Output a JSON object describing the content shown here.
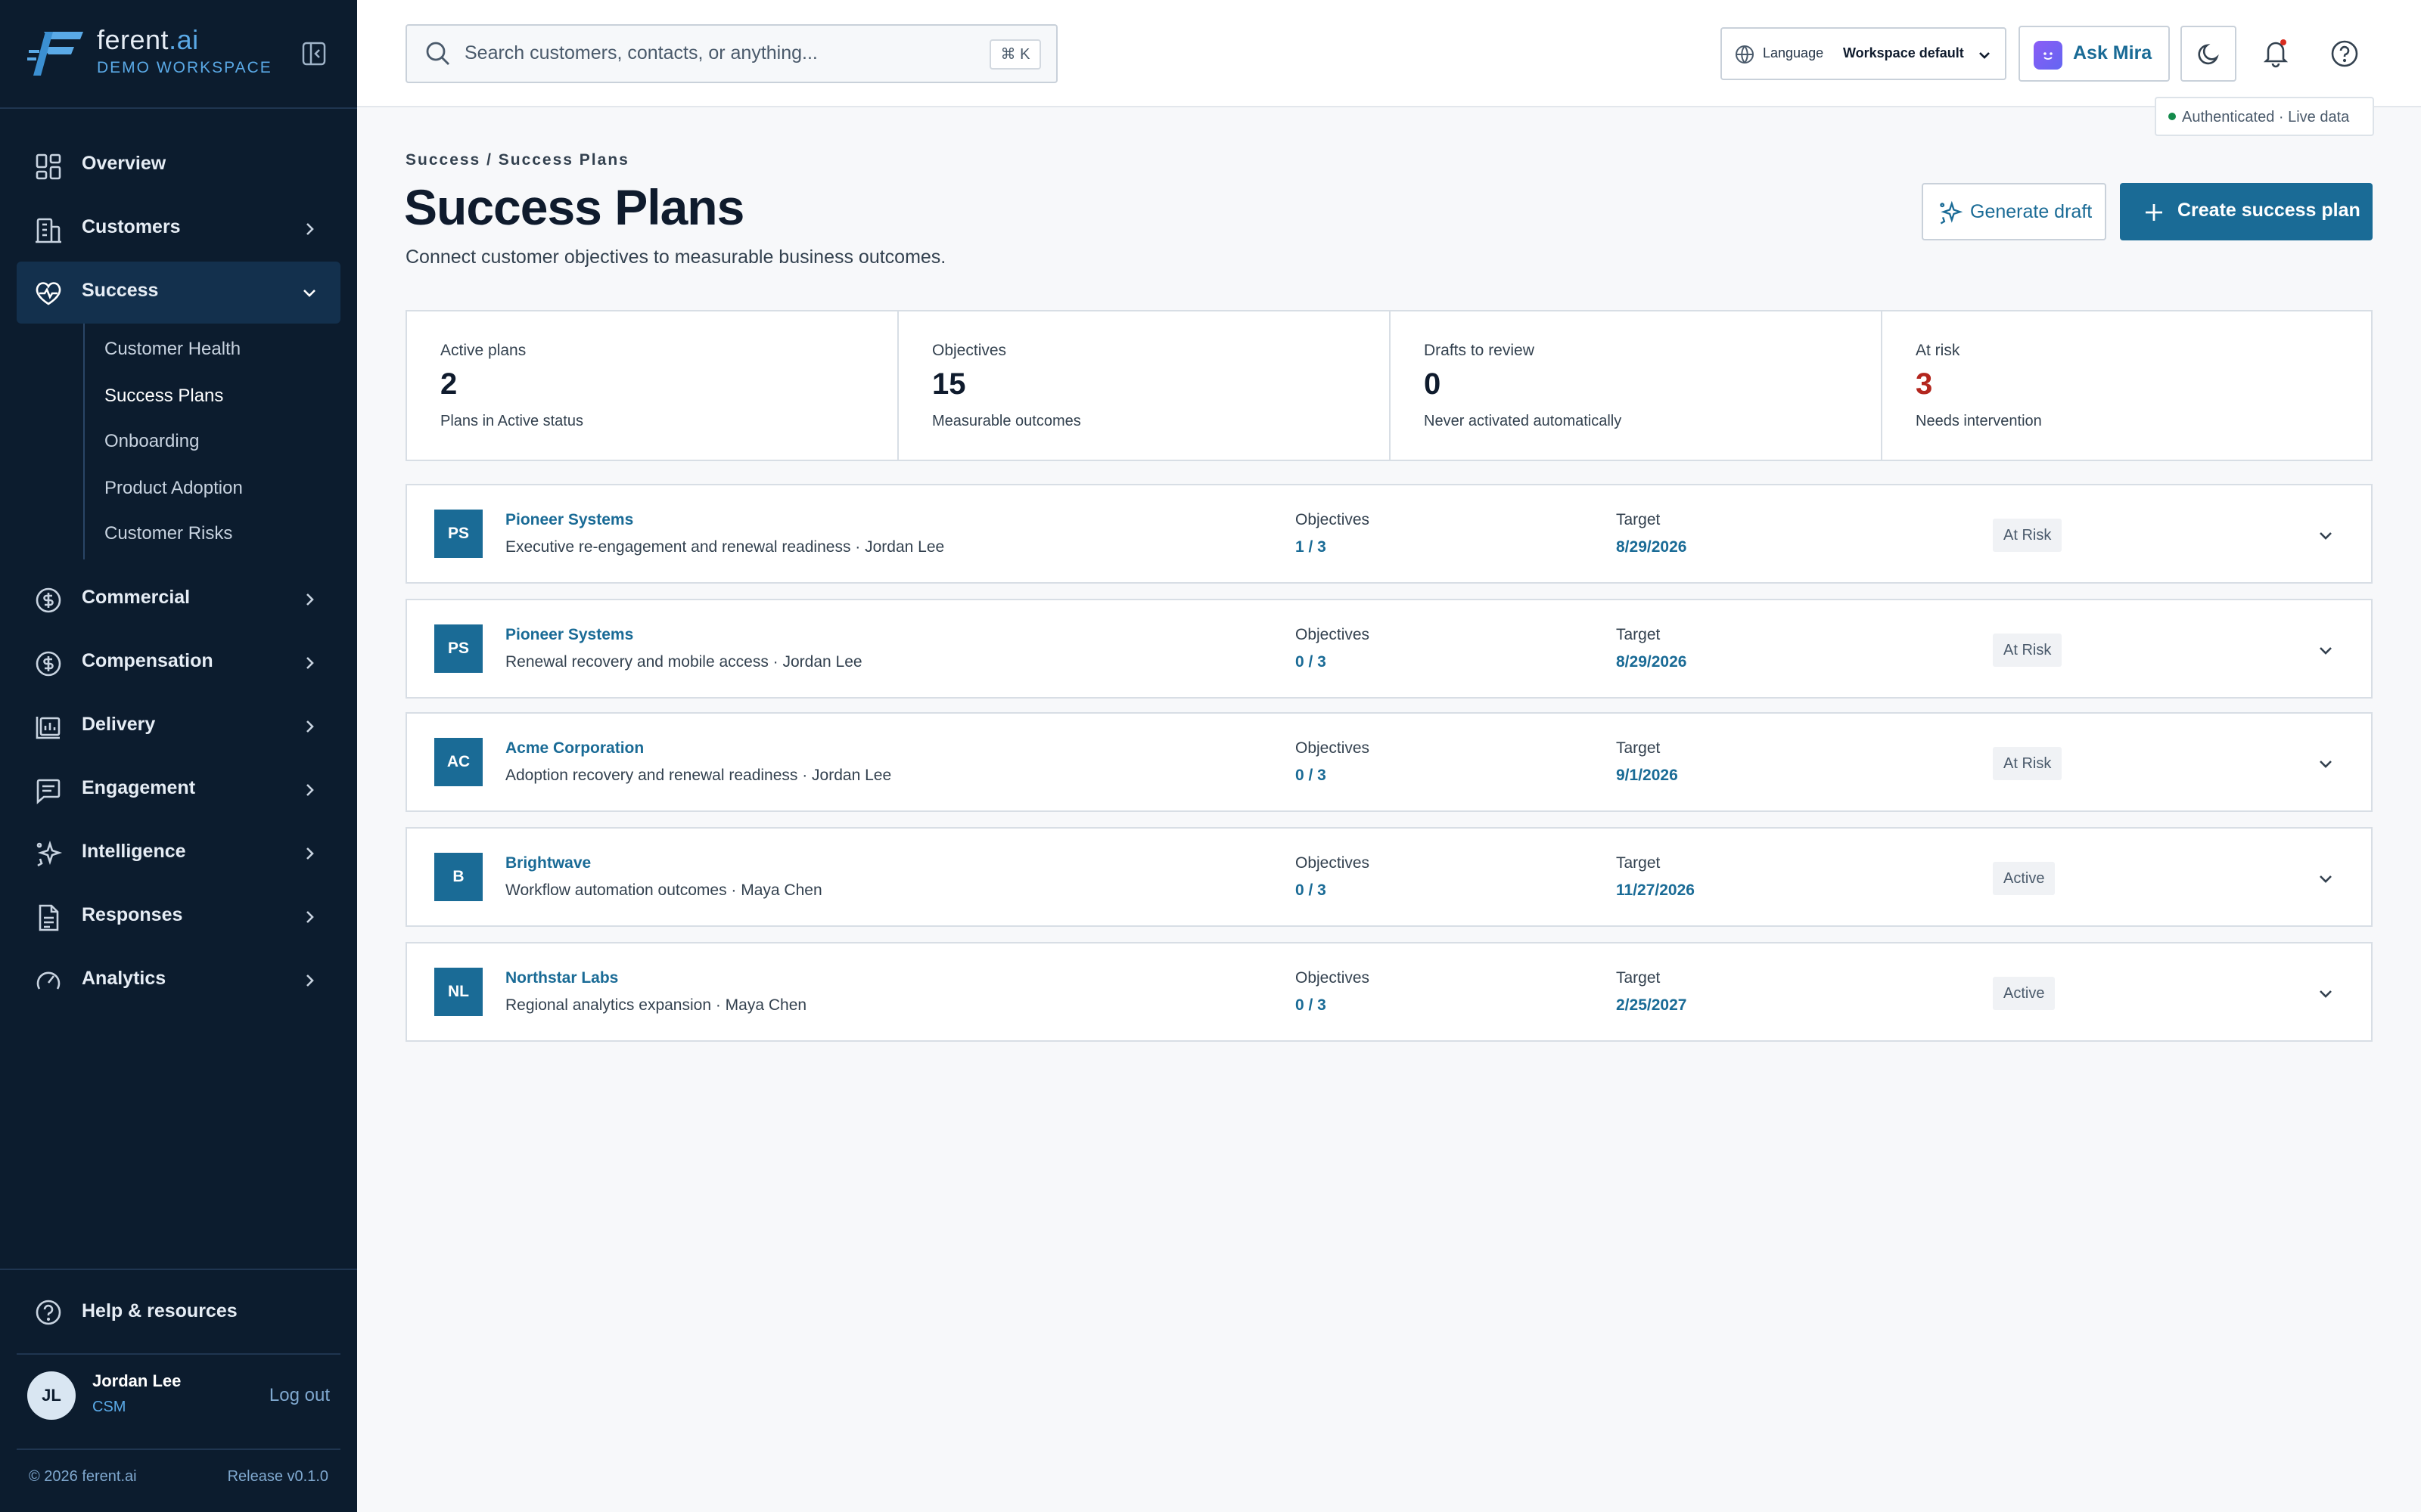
{
  "brand": {
    "name_a": "ferent",
    "name_b": ".ai",
    "workspace": "DEMO WORKSPACE"
  },
  "sidebar": {
    "items": [
      {
        "label": "Overview",
        "icon": "grid-icon"
      },
      {
        "label": "Customers",
        "icon": "building-icon"
      },
      {
        "label": "Success",
        "icon": "heart-pulse-icon",
        "expanded": true
      },
      {
        "label": "Commercial",
        "icon": "dollar-circle-icon"
      },
      {
        "label": "Compensation",
        "icon": "dollar-circle-icon"
      },
      {
        "label": "Delivery",
        "icon": "chart-box-icon"
      },
      {
        "label": "Engagement",
        "icon": "message-icon"
      },
      {
        "label": "Intelligence",
        "icon": "sparkle-icon"
      },
      {
        "label": "Responses",
        "icon": "document-icon"
      },
      {
        "label": "Analytics",
        "icon": "gauge-icon"
      }
    ],
    "sub_items": [
      "Customer Health",
      "Success Plans",
      "Onboarding",
      "Product Adoption",
      "Customer Risks"
    ],
    "current_sub": "Success Plans",
    "help": "Help & resources",
    "user": {
      "initials": "JL",
      "name": "Jordan Lee",
      "role": "CSM",
      "logout": "Log out"
    },
    "footer": {
      "copyright": "© 2026 ferent.ai",
      "release": "Release v0.1.0"
    }
  },
  "topbar": {
    "search_placeholder": "Search customers, contacts, or anything...",
    "shortcut": "⌘ K",
    "language_label": "Language",
    "language_value": "Workspace default",
    "ask": "Ask Mira",
    "auth_status": "Authenticated · Live data"
  },
  "page": {
    "breadcrumb": "Success / Success Plans",
    "title": "Success Plans",
    "subtitle": "Connect customer objectives to measurable business outcomes.",
    "generate_draft": "Generate draft",
    "create": "Create success plan"
  },
  "stats": [
    {
      "label": "Active plans",
      "value": "2",
      "sub": "Plans in Active status"
    },
    {
      "label": "Objectives",
      "value": "15",
      "sub": "Measurable outcomes"
    },
    {
      "label": "Drafts to review",
      "value": "0",
      "sub": "Never activated automatically"
    },
    {
      "label": "At risk",
      "value": "3",
      "sub": "Needs intervention"
    }
  ],
  "plans": [
    {
      "initials": "PS",
      "customer": "Pioneer Systems",
      "desc": "Executive re-engagement and renewal readiness · Jordan Lee",
      "obj_label": "Objectives",
      "objectives": "1 / 3",
      "target_label": "Target",
      "target": "8/29/2026",
      "status": "At Risk"
    },
    {
      "initials": "PS",
      "customer": "Pioneer Systems",
      "desc": "Renewal recovery and mobile access · Jordan Lee",
      "obj_label": "Objectives",
      "objectives": "0 / 3",
      "target_label": "Target",
      "target": "8/29/2026",
      "status": "At Risk"
    },
    {
      "initials": "AC",
      "customer": "Acme Corporation",
      "desc": "Adoption recovery and renewal readiness · Jordan Lee",
      "obj_label": "Objectives",
      "objectives": "0 / 3",
      "target_label": "Target",
      "target": "9/1/2026",
      "status": "At Risk"
    },
    {
      "initials": "B",
      "customer": "Brightwave",
      "desc": "Workflow automation outcomes · Maya Chen",
      "obj_label": "Objectives",
      "objectives": "0 / 3",
      "target_label": "Target",
      "target": "11/27/2026",
      "status": "Active"
    },
    {
      "initials": "NL",
      "customer": "Northstar Labs",
      "desc": "Regional analytics expansion · Maya Chen",
      "obj_label": "Objectives",
      "objectives": "0 / 3",
      "target_label": "Target",
      "target": "2/25/2027",
      "status": "Active"
    }
  ],
  "colors": {
    "sidebar_bg": "#0c1c2e",
    "accent": "#1a6b96",
    "risk": "#b3261e",
    "brand_blue": "#5aa9e6"
  }
}
